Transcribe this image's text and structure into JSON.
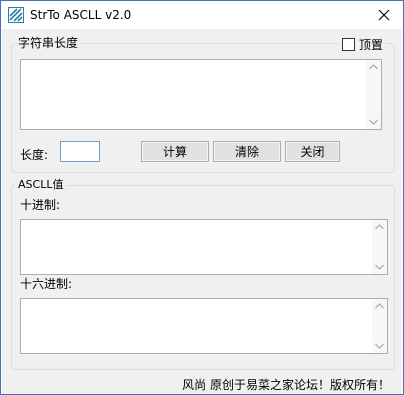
{
  "window": {
    "title": "StrTo  ASCLL v2.0",
    "close_symbol": "✕"
  },
  "group_input": {
    "legend": "字符串长度",
    "pin_label": "顶置",
    "pin_checked": false,
    "input_text": ""
  },
  "controls": {
    "length_label": "长度:",
    "length_value": "",
    "calc_label": "计算",
    "clear_label": "清除",
    "close_label": "关闭"
  },
  "group_ascii": {
    "legend": "ASCLL值",
    "decimal_label": "十进制:",
    "decimal_value": "",
    "hex_label": "十六进制:",
    "hex_value": ""
  },
  "footer": {
    "text": "风尚    原创于易菜之家论坛！版权所有！"
  },
  "colors": {
    "face": "#f0f0f0",
    "border_accent": "#4a6fb5",
    "icon": "#2a7fa6"
  },
  "icons": {
    "app": "app-logo-icon",
    "close": "close-icon",
    "scroll_up": "scroll-up-icon",
    "scroll_down": "scroll-down-icon"
  }
}
